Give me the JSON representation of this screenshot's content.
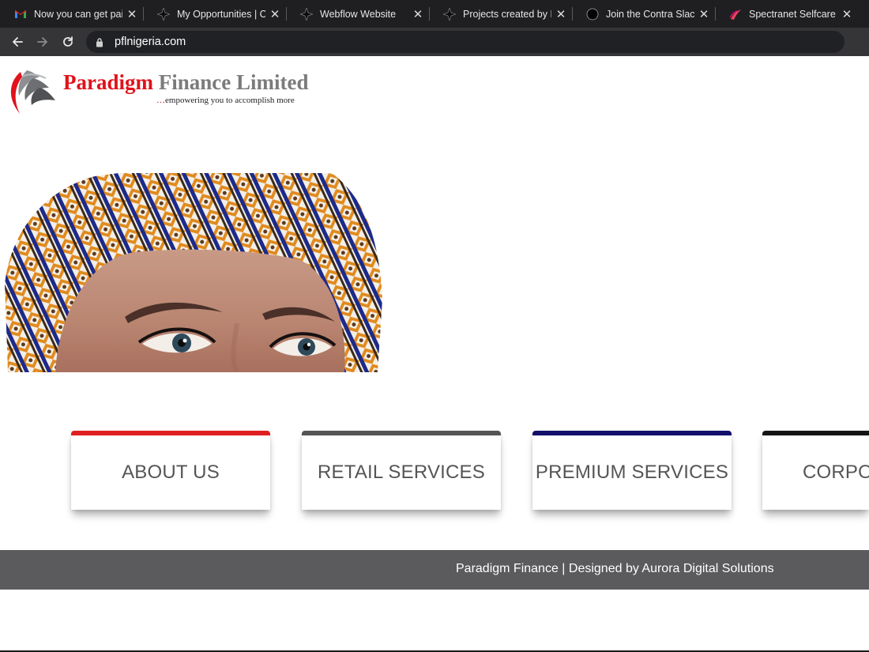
{
  "browser": {
    "tabs": [
      {
        "title": "Now you can get paid",
        "icon": "gmail-icon"
      },
      {
        "title": "My Opportunities | Co",
        "icon": "contra-diamond-icon"
      },
      {
        "title": "Webflow Website",
        "icon": "contra-diamond-icon"
      },
      {
        "title": "Projects created by Pa",
        "icon": "contra-diamond-icon"
      },
      {
        "title": "Join the Contra Slack",
        "icon": "circle-icon"
      },
      {
        "title": "Spectranet Selfcare",
        "icon": "spectranet-icon"
      }
    ],
    "url": "pflnigeria.com"
  },
  "site": {
    "brand_red": "Paradigm",
    "brand_grey": "Finance Limited",
    "tagline_dots": "…",
    "tagline": "empowering you to accomplish more",
    "cards": [
      {
        "label": "ABOUT US",
        "color": "#e02020"
      },
      {
        "label": "RETAIL SERVICES",
        "color": "#555555"
      },
      {
        "label": "PREMIUM SERVICES",
        "color": "#12106b"
      },
      {
        "label": "CORPO",
        "color": "#151515"
      }
    ],
    "footer": "Paradigm Finance | Designed by Aurora Digital Solutions"
  },
  "colors": {
    "tabbar": "#1f1f21",
    "toolbar": "#353538",
    "footer_bg": "#5b5a5c",
    "brand_red": "#e0121a",
    "brand_grey": "#7b7b7b"
  }
}
